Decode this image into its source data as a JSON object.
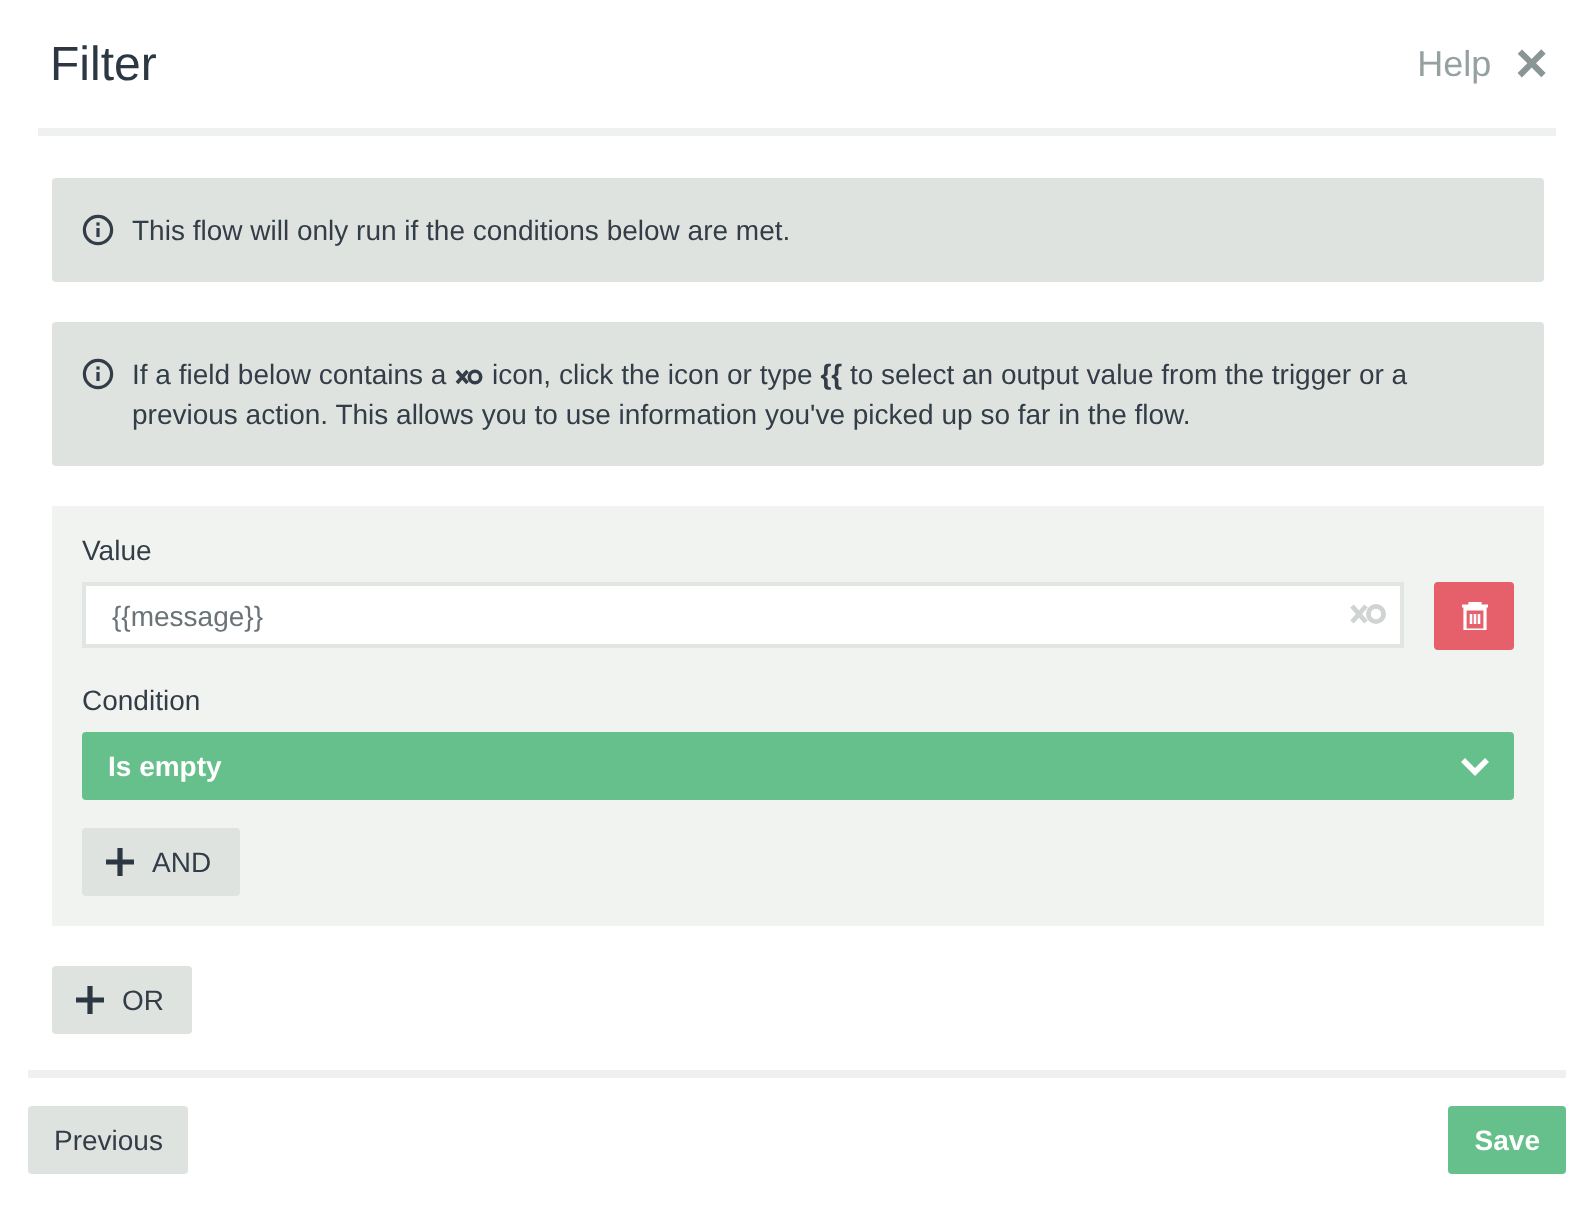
{
  "dialog": {
    "title": "Filter",
    "help": "Help",
    "close": "×"
  },
  "notices": [
    {
      "text": "This flow will only run if the conditions below are met."
    },
    {
      "text_before": "If a field below contains a",
      "text_after": "icon, click the icon or type **{{** to select an output value from the trigger or a",
      "text_next_line": "previous action. This allows you to use information you've picked up so far in the flow."
    }
  ],
  "condition_group": {
    "value_label": "Value",
    "value": "{{message}}",
    "condition_label": "Condition",
    "condition": "Is empty",
    "and_button": "AND"
  },
  "or_button": "OR",
  "footer": {
    "previous": "Previous",
    "save": "Save"
  }
}
